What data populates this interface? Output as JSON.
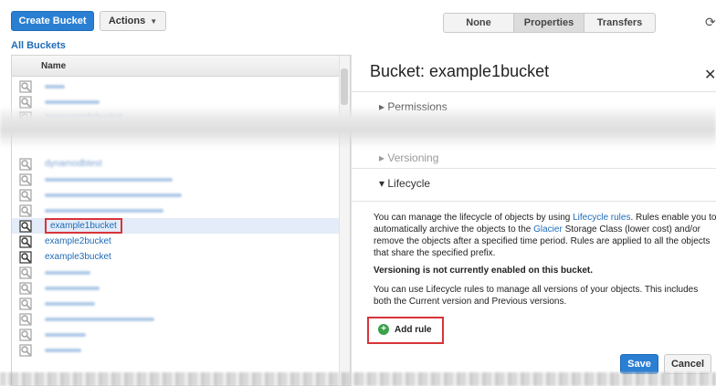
{
  "toolbar": {
    "create_bucket": "Create Bucket",
    "actions": "Actions",
    "view_none": "None",
    "view_properties": "Properties",
    "view_transfers": "Transfers"
  },
  "breadcrumb": "All Buckets",
  "bucket_list": {
    "column_header": "Name",
    "buckets": [
      {
        "name": "",
        "blurred": true
      },
      {
        "name": "",
        "blurred": true
      },
      {
        "name": "awsexamplebucket",
        "blurred": true
      },
      {
        "name": "dynamodbtest",
        "blurred": true
      },
      {
        "name": "",
        "blurred": true
      },
      {
        "name": "",
        "blurred": true
      },
      {
        "name": "",
        "blurred": true
      },
      {
        "name": "example1bucket",
        "blurred": false,
        "selected": true
      },
      {
        "name": "example2bucket",
        "blurred": false
      },
      {
        "name": "example3bucket",
        "blurred": false
      },
      {
        "name": "",
        "blurred": true
      },
      {
        "name": "",
        "blurred": true
      },
      {
        "name": "",
        "blurred": true
      },
      {
        "name": "",
        "blurred": true
      },
      {
        "name": "",
        "blurred": true
      },
      {
        "name": "",
        "blurred": true
      }
    ]
  },
  "properties": {
    "title": "Bucket: example1bucket",
    "sections": {
      "permissions": "Permissions",
      "versioning": "Versioning",
      "lifecycle": "Lifecycle"
    },
    "lifecycle_text_1": "You can manage the lifecycle of objects by using",
    "lifecycle_link": "Lifecycle rules",
    "lifecycle_text_2": ". Rules enable you to automatically archive the objects to the",
    "glacier_link": "Glacier",
    "lifecycle_text_3": "Storage Class (lower cost) and/or remove the objects after a specified time period. Rules are applied to all the objects that share the specified prefix.",
    "versioning_warning": "Versioning is not currently enabled on this bucket.",
    "versions_note": "You can use Lifecycle rules to manage all versions of your objects. This includes both the Current version and Previous versions.",
    "add_rule": "Add rule",
    "save": "Save",
    "cancel": "Cancel"
  }
}
